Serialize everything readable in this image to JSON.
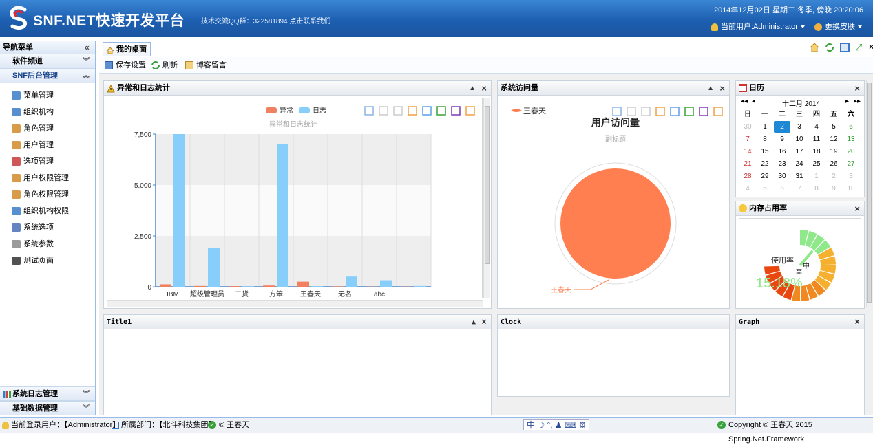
{
  "header": {
    "app_title": "SNF.NET快速开发平台",
    "subtitle": "技术交流QQ群：322581894 点击联系我们",
    "datetime": "2014年12月02日 星期二 冬季, 傍晚 20:20:06",
    "current_user": "当前用户:Administrator",
    "skin": "更换皮肤"
  },
  "sidebar": {
    "title": "导航菜单",
    "groups_top": [
      "软件频道",
      "SNF后台管理"
    ],
    "items": [
      {
        "label": "菜单管理",
        "icon": "tree-icon",
        "color": "#3a7bc8"
      },
      {
        "label": "组织机构",
        "icon": "org-icon",
        "color": "#3a7bc8"
      },
      {
        "label": "角色管理",
        "icon": "role-icon",
        "color": "#d08a2a"
      },
      {
        "label": "用户管理",
        "icon": "user-icon",
        "color": "#d08a2a"
      },
      {
        "label": "选项管理",
        "icon": "option-icon",
        "color": "#c83a3a"
      },
      {
        "label": "用户权限管理",
        "icon": "user-perm-icon",
        "color": "#d08a2a"
      },
      {
        "label": "角色权限管理",
        "icon": "role-perm-icon",
        "color": "#d08a2a"
      },
      {
        "label": "组织机构权限",
        "icon": "org-perm-icon",
        "color": "#3a7bc8"
      },
      {
        "label": "系统选项",
        "icon": "sys-option-icon",
        "color": "#4a6fb5"
      },
      {
        "label": "系统参数",
        "icon": "sys-param-icon",
        "color": "#8a8a8a"
      },
      {
        "label": "测试页面",
        "icon": "ball-icon",
        "color": "#333333"
      }
    ],
    "groups_bottom": [
      "系统日志管理",
      "基础数据管理"
    ]
  },
  "tabs": [
    {
      "label": "我的桌面"
    }
  ],
  "toolbar": {
    "save": "保存设置",
    "refresh": "刷新",
    "blog": "博客留言"
  },
  "panels": {
    "log": {
      "title": "异常和日志统计"
    },
    "visit": {
      "title": "系统访问量"
    },
    "calendar": {
      "title": "日历"
    },
    "memory": {
      "title": "内存占用率"
    },
    "title1": {
      "title": "Title1"
    },
    "clock": {
      "title": "Clock"
    },
    "graph": {
      "title": "Graph"
    }
  },
  "chart_data": [
    {
      "type": "bar",
      "title": "异常和日志统计",
      "categories": [
        "IBM",
        "超级管理员",
        "二货",
        "方笨",
        "王春天",
        "无名",
        "abc",
        ""
      ],
      "series": [
        {
          "name": "异常",
          "color": "#f08060",
          "values": [
            120,
            40,
            30,
            60,
            250,
            20,
            10,
            10
          ]
        },
        {
          "name": "日志",
          "color": "#87cefa",
          "values": [
            7500,
            1900,
            20,
            7000,
            30,
            500,
            320,
            40
          ]
        }
      ],
      "ylim": [
        0,
        7500
      ],
      "yticks": [
        "0",
        "2,500",
        "5,000",
        "7,500"
      ],
      "grid": true,
      "legend": "top"
    },
    {
      "type": "pie",
      "title": "用户访问量",
      "subtitle": "副标题",
      "series": [
        {
          "name": "王春天",
          "color": "#ff7f50",
          "values": [
            100
          ]
        }
      ],
      "labels": [
        "王春天"
      ],
      "legend": "top-left"
    }
  ],
  "calendar": {
    "month_label": "十二月 2014",
    "weekdays": [
      "日",
      "一",
      "二",
      "三",
      "四",
      "五",
      "六"
    ],
    "weeks": [
      [
        "30",
        "1",
        "2",
        "3",
        "4",
        "5",
        "6"
      ],
      [
        "7",
        "8",
        "9",
        "10",
        "11",
        "12",
        "13"
      ],
      [
        "14",
        "15",
        "16",
        "17",
        "18",
        "19",
        "20"
      ],
      [
        "21",
        "22",
        "23",
        "24",
        "25",
        "26",
        "27"
      ],
      [
        "28",
        "29",
        "30",
        "31",
        "1",
        "2",
        "3"
      ],
      [
        "4",
        "5",
        "6",
        "7",
        "8",
        "9",
        "10"
      ]
    ],
    "today": "2"
  },
  "gauge": {
    "label": "使用率",
    "value_text": "15.18%",
    "center": "中",
    "value": 15.18,
    "unit_char": "高"
  },
  "statusbar": {
    "login_user": "当前登录用户：【Administrator】",
    "dept": "所属部门：【北斗科技集团】",
    "author": "© 王春天",
    "copyright": "Copyright © 王春天 2015 Spring.Net.Framework",
    "ime": "中"
  }
}
